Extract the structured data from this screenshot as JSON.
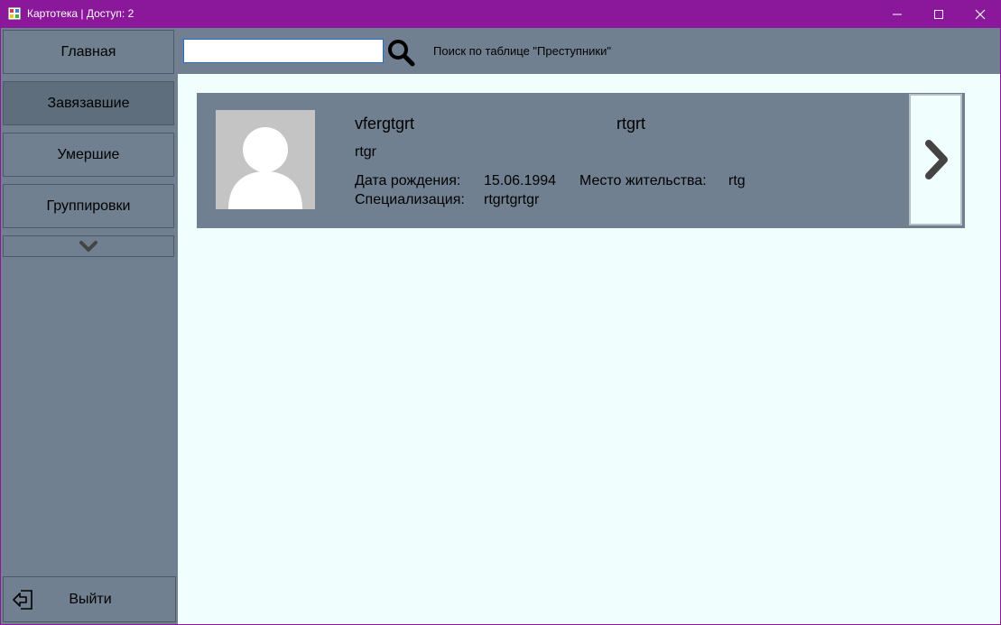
{
  "window": {
    "title": "Картотека | Доступ: 2",
    "accent_color": "#8b189a",
    "controls": [
      "minimize-icon",
      "maximize-icon",
      "close-icon"
    ]
  },
  "sidebar": {
    "items": [
      {
        "label": "Главная",
        "active": false
      },
      {
        "label": "Завязавшие",
        "active": true
      },
      {
        "label": "Умершие",
        "active": false
      },
      {
        "label": "Группировки",
        "active": false
      }
    ],
    "more_icon": "chevron-down-icon",
    "logout": {
      "label": "Выйти",
      "icon": "logout-icon"
    }
  },
  "search": {
    "value": "",
    "placeholder": "",
    "icon": "search-icon",
    "label": "Поиск по таблице \"Преступники\""
  },
  "cards": [
    {
      "last_name": "vfergtgrt",
      "first_name": "rtgrt",
      "patronymic": "rtgr",
      "birth_date_label": "Дата рождения:",
      "birth_date": "15.06.1994",
      "residence_label": "Место жительства:",
      "residence": "rtg",
      "specialization_label": "Специализация:",
      "specialization": "rtgrtgrtgr",
      "avatar_icon": "user-silhouette-icon",
      "open_icon": "chevron-right-icon"
    }
  ],
  "colors": {
    "panel": "#708090",
    "content_bg": "#f0fffe",
    "avatar_bg": "#c4c4c4"
  }
}
